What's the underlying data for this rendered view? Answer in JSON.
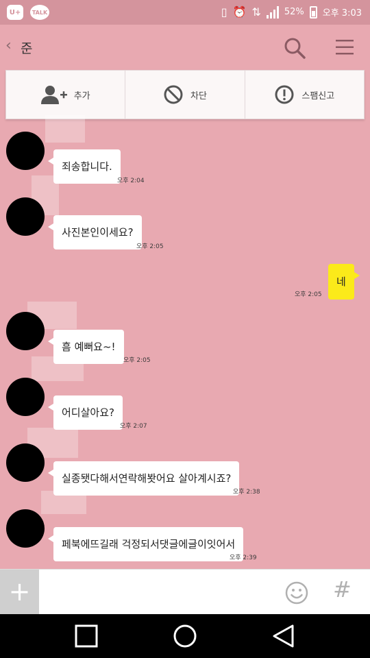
{
  "status_bar": {
    "left_icons": [
      "U+",
      "TALK"
    ],
    "battery_percent": "52%",
    "time": "오후 3:03",
    "icons": [
      "vibrate-icon",
      "alarm-icon",
      "lte-icon",
      "signal-icon",
      "battery-icon"
    ]
  },
  "header": {
    "back_glyph": "‹",
    "title": "준",
    "icons": [
      "search-icon",
      "menu-icon"
    ]
  },
  "actions": [
    {
      "label": "추가",
      "icon": "add-friend-icon"
    },
    {
      "label": "차단",
      "icon": "block-icon"
    },
    {
      "label": "스팸신고",
      "icon": "report-icon"
    }
  ],
  "messages": [
    {
      "text": "죄송합니다.",
      "time": "오후 2:04",
      "from": "other"
    },
    {
      "text": "사진본인이세요?",
      "time": "오후 2:05",
      "from": "other"
    },
    {
      "text": "네",
      "time": "오후 2:05",
      "from": "me"
    },
    {
      "text": "흠 예뻐요~!",
      "time": "오후 2:05",
      "from": "other"
    },
    {
      "text": "어디살아요?",
      "time": "오후 2:07",
      "from": "other"
    },
    {
      "text": "실종됏다해서연락해봣어요 살아계시죠?",
      "time": "오후 2:38",
      "from": "other"
    },
    {
      "text": "페북에뜨길래 걱정되서댓글에글이잇어서",
      "time": "오후 2:39",
      "from": "other"
    }
  ],
  "input_bar": {
    "plus_label": "+",
    "placeholder": "",
    "hash_label": "#"
  },
  "nav_bar": [
    "recent-apps-button",
    "home-button",
    "back-button"
  ],
  "colors": {
    "chat_background": "#e8a9b1",
    "my_bubble": "#fbea1a",
    "other_bubble": "#ffffff"
  }
}
